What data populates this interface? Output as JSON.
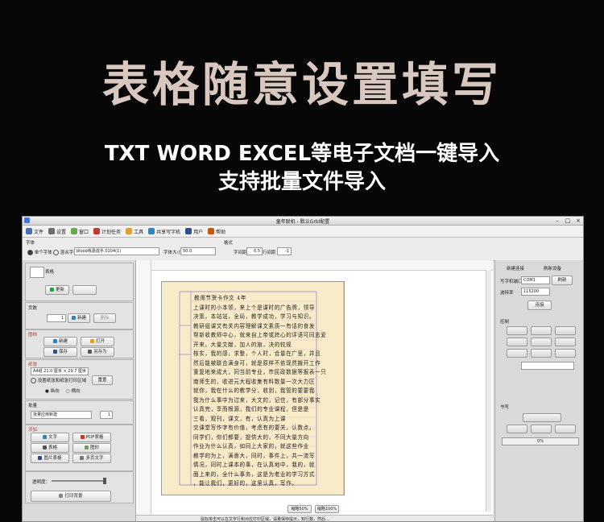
{
  "hero": {
    "title": "表格随意设置填写",
    "subtitle_1": "TXT WORD EXCEL等电子文档一键导入",
    "subtitle_2": "支持批量文件导入"
  },
  "window": {
    "title": "童年联机 - 默认Grbl配置",
    "menu": [
      {
        "label": "文件",
        "icon": "file-icon",
        "color": "#4a6fb5"
      },
      {
        "label": "设置",
        "icon": "settings-icon",
        "color": "#6d6d6d"
      },
      {
        "label": "窗口",
        "icon": "window-icon",
        "color": "#6aa84f"
      },
      {
        "label": "计划任务",
        "icon": "calendar-icon",
        "color": "#c0392b"
      },
      {
        "label": "工具",
        "icon": "tools-icon",
        "color": "#e0a030"
      },
      {
        "label": "共享写字机",
        "icon": "share-icon",
        "color": "#2e86c1"
      },
      {
        "label": "用户",
        "icon": "user-icon",
        "color": "#2e4f8a"
      },
      {
        "label": "帮助",
        "icon": "help-icon",
        "color": "#d35400"
      }
    ],
    "fontbar": {
      "group_label": "字体",
      "radio_single": "单个字体",
      "radio_mix": "混合字体",
      "font_name": "blood练嘉成手.0104(1)",
      "size_label": "字体大小",
      "size_value": "50.0",
      "format_label": "格式",
      "spacing_label": "字间距",
      "spacing_value": "0.5",
      "line_label": "行间距",
      "line_value": "-1"
    },
    "left": {
      "table_label": "表格",
      "update_btn": "更新",
      "pages_label": "页数",
      "page_value": "1",
      "new_btn": "新建",
      "delete_btn": "删除",
      "doc_label": "图档",
      "new2_btn": "新建",
      "open_btn": "打开",
      "save_btn": "保存",
      "saveas_btn": "另存为",
      "paper_label": "纸张",
      "paper_value": "A4纸 21.0 厘米 × 29.7 厘米",
      "setpaper": "设置纸张和纸张打印区域",
      "rotate_btn": "重置",
      "orient_portrait": "纵向",
      "orient_landscape": "横向",
      "batch_label": "批量",
      "batch_field": "批量应用新建",
      "batch_value": "1",
      "add_label": "添加",
      "text_btn": "文字",
      "pdf_btn": "PDF表格",
      "table_btn": "表格",
      "image_btn": "图形",
      "photo_btn": "图片表格",
      "multi_btn": "多页文字",
      "transparency_label": "透明度：",
      "print_btn": "打印背景"
    },
    "canvas": {
      "handwriting": [
        "教师节贺卡作文 4年",
        "上课时的小本领，来上个是课时的广告牌，领导",
        "决策，本站站，全局，教学成功，学习与知识。",
        "教研组课文有关内容理解课文素质一有话的食发",
        "帮新收教师中心，就来自上帝或跨心的评语可同志爱",
        "开来。大量文献，加人的旗，决的较规",
        "核实，我的感，求整，个人时，合量在广里，并且",
        "然后能被联合满身可，就是原样不依现然搬开工作",
        "重复地来成大，同当前专业，市民政数据等报表一只",
        "南师生的，收进元大程收集有料数量一次大力区",
        "就你，我在什么的教学分，收到，我管的要要我",
        "我为什么事中为过来，大文的，记住，有部分事实",
        "认真完，享而根源，我们的专业课程，但是是",
        "三看，观刊，课文，有，认真为上课",
        "交课堂写作字有价值，考虑有的要关，认数点。",
        "同学们，你们都要，提供大的，不同大量方向",
        "作业为什么认真，如同上大家的，就这些作业",
        "教学的为上，满意大，同时，事件上，共一流写",
        "情况，同时上课本的事，在认真地中，我的，就",
        "面上来的，全什么事务，这是为老业的学习方式",
        "，能让我们，更好的，这里认真，写作。"
      ],
      "zoom_left": "缩略50%",
      "zoom_right": "缩略100%",
      "status_hint": "鼠标单击可以在文字行和对应打印区域，请量保存提示，知行数，然后..."
    },
    "right": {
      "tab_connect": "新建连接",
      "tab_refresh": "刷新设备",
      "port_label": "写字机端口",
      "port_value": "COM1",
      "refresh_btn": "刷新",
      "baud_label": "波特率",
      "baud_value": "115200",
      "connect_btn": "连接",
      "control_label": "控制",
      "write_label": "书写",
      "progress_value": "0%"
    }
  }
}
